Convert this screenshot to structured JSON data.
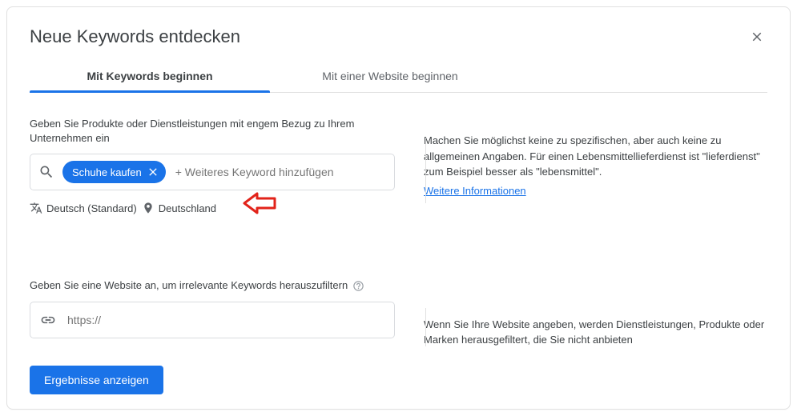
{
  "header": {
    "title": "Neue Keywords entdecken"
  },
  "tabs": {
    "keywords": "Mit Keywords beginnen",
    "website": "Mit einer Website beginnen"
  },
  "section1": {
    "label": "Geben Sie Produkte oder Dienstleistungen mit engem Bezug zu Ihrem Unternehmen ein",
    "chip": "Schuhe kaufen",
    "placeholder": "+ Weiteres Keyword hinzufügen",
    "language": "Deutsch (Standard)",
    "location": "Deutschland"
  },
  "tip1": {
    "text": "Machen Sie möglichst keine zu spezifischen, aber auch keine zu allgemeinen Angaben. Für einen Lebensmittellieferdienst ist \"lieferdienst\" zum Beispiel besser als \"lebensmittel\".",
    "link": "Weitere Informationen"
  },
  "section2": {
    "label": "Geben Sie eine Website an, um irrelevante Keywords herauszufiltern",
    "placeholder": "https://"
  },
  "tip2": {
    "text": "Wenn Sie Ihre Website angeben, werden Dienstleistungen, Produkte oder Marken herausgefiltert, die Sie nicht anbieten"
  },
  "button": {
    "submit": "Ergebnisse anzeigen"
  }
}
